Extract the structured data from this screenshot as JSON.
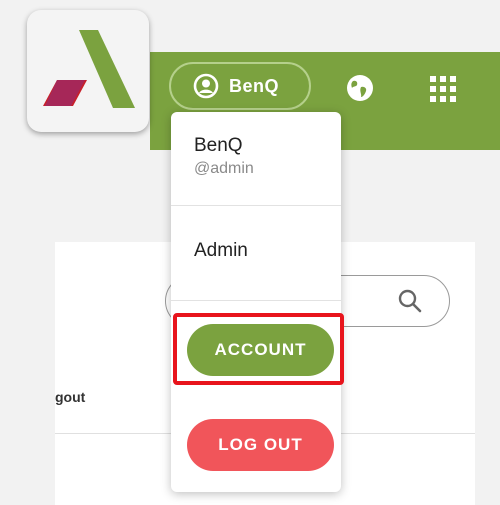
{
  "header": {
    "user_label": "BenQ",
    "icons": [
      "user-avatar-icon",
      "globe-icon",
      "apps-grid-icon"
    ]
  },
  "logo": {
    "icon": "app-logo-icon"
  },
  "background_card": {
    "search_icon": "search-icon",
    "partial_text": "gout"
  },
  "dropdown": {
    "display_name": "BenQ",
    "handle": "@admin",
    "role": "Admin",
    "account_label": "ACCOUNT",
    "logout_label": "LOG OUT"
  },
  "colors": {
    "brand_green": "#7ba23f",
    "logout_red": "#f1555a",
    "highlight_red": "#e8141c"
  }
}
